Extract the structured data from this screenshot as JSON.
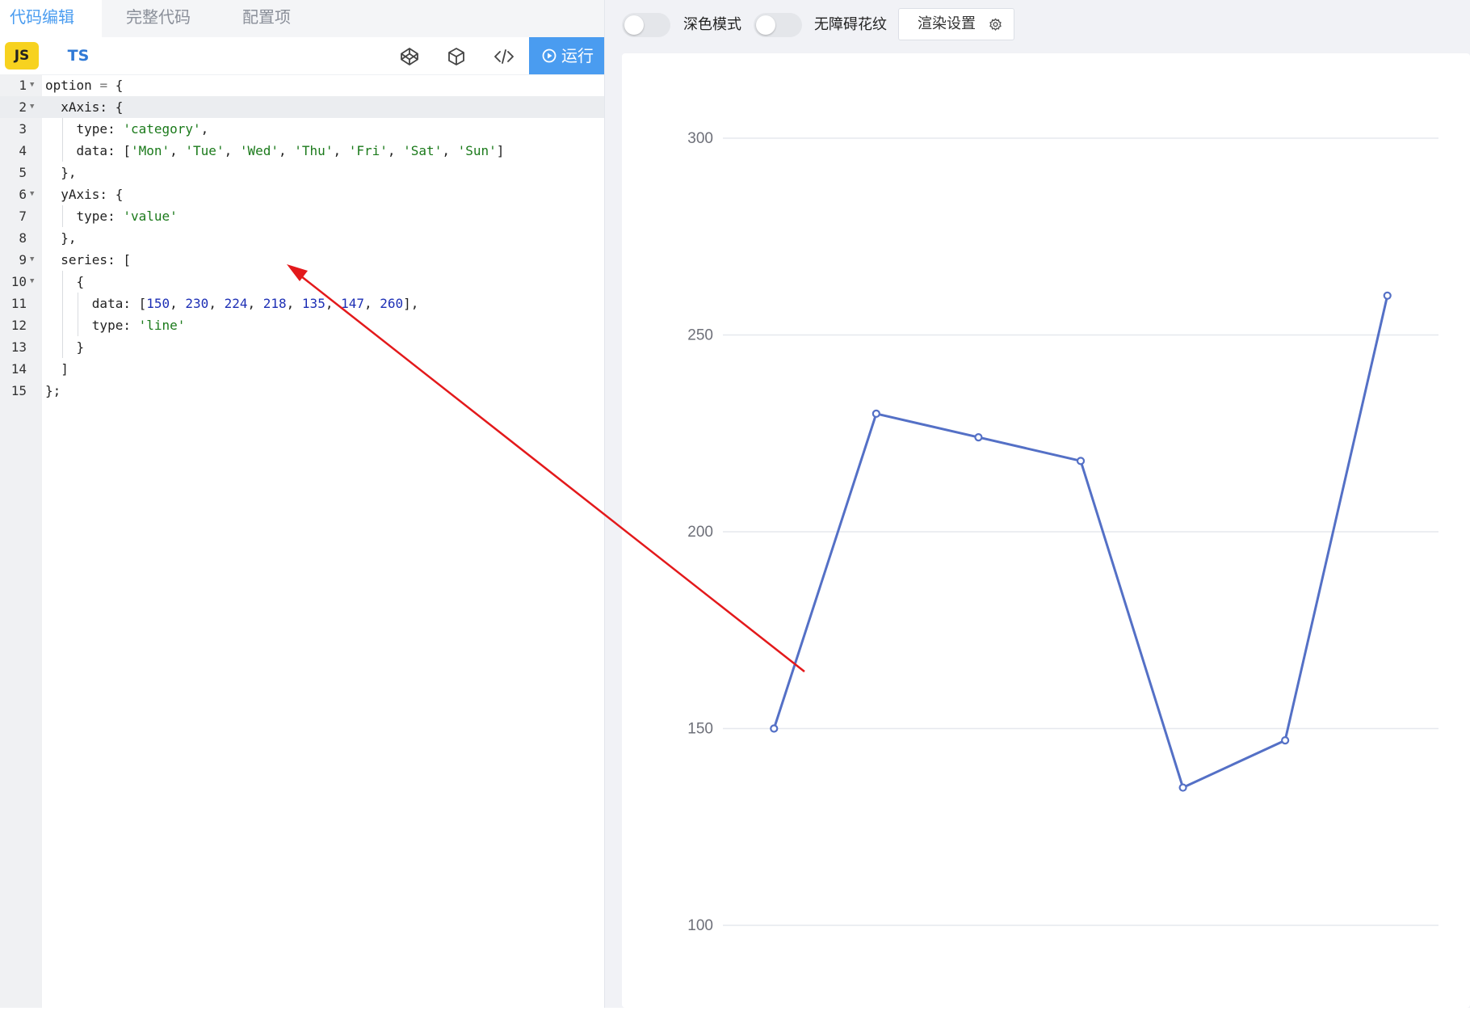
{
  "editor": {
    "tabs": [
      {
        "label": "代码编辑",
        "active": true
      },
      {
        "label": "完整代码",
        "active": false
      },
      {
        "label": "配置项",
        "active": false
      }
    ],
    "lang": {
      "js": "JS",
      "ts": "TS"
    },
    "tools": [
      "codepen-icon",
      "codesandbox-icon",
      "embed-code-icon"
    ],
    "run_label": "运行",
    "code_lines": [
      "option = {",
      "  xAxis: {",
      "    type: 'category',",
      "    data: ['Mon', 'Tue', 'Wed', 'Thu', 'Fri', 'Sat', 'Sun']",
      "  },",
      "  yAxis: {",
      "    type: 'value'",
      "  },",
      "  series: [",
      "    {",
      "      data: [150, 230, 224, 218, 135, 147, 260],",
      "      type: 'line'",
      "    }",
      "  ]",
      "};"
    ],
    "highlighted_line": 2
  },
  "preview": {
    "toggles": [
      {
        "label": "深色模式",
        "on": false
      },
      {
        "label": "无障碍花纹",
        "on": false
      }
    ],
    "render_settings_label": "渲染设置"
  },
  "colors": {
    "accent": "#4a9cf0",
    "series": "#5470c6",
    "annotation_arrow": "#e3191b"
  },
  "chart_data": {
    "type": "line",
    "categories": [
      "Mon",
      "Tue",
      "Wed",
      "Thu",
      "Fri",
      "Sat",
      "Sun"
    ],
    "series": [
      {
        "values": [
          150,
          230,
          224,
          218,
          135,
          147,
          260
        ]
      }
    ],
    "y_ticks": [
      100,
      150,
      200,
      250,
      300
    ],
    "ylim": [
      100,
      300
    ],
    "grid": true
  }
}
